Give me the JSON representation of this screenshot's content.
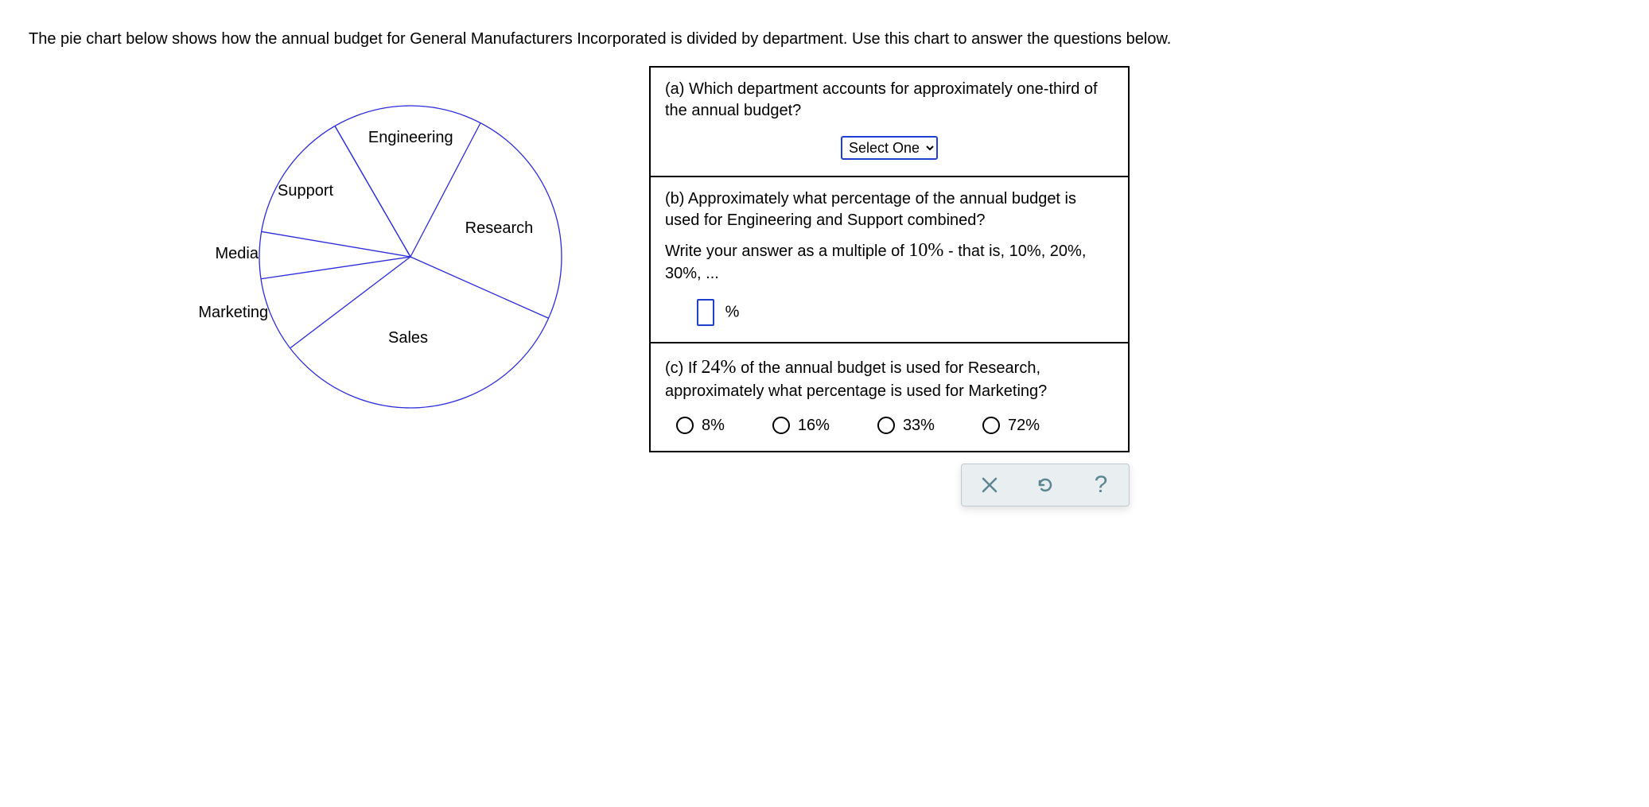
{
  "intro": "The pie chart below shows how the annual budget for General Manufacturers Incorporated is divided by department. Use this chart to answer the questions below.",
  "chart_data": {
    "type": "pie",
    "title": "",
    "categories": [
      "Engineering",
      "Research",
      "Sales",
      "Marketing",
      "Media",
      "Support"
    ],
    "values": [
      16,
      24,
      33,
      8,
      5,
      14
    ],
    "series": [
      {
        "name": "Engineering",
        "value": 16
      },
      {
        "name": "Research",
        "value": 24
      },
      {
        "name": "Sales",
        "value": 33
      },
      {
        "name": "Marketing",
        "value": 8
      },
      {
        "name": "Media",
        "value": 5
      },
      {
        "name": "Support",
        "value": 14
      }
    ],
    "start_angle_deg": -30,
    "direction": "clockwise",
    "slice_fill": "none",
    "slice_stroke": "#2b2bdc"
  },
  "questions": {
    "a": {
      "text": "(a) Which department accounts for approximately one-third of the annual budget?",
      "select_placeholder": "Select One"
    },
    "b": {
      "text1": "(b) Approximately what percentage of the annual budget is used for Engineering and Support combined?",
      "text2a": "Write your answer as a multiple of ",
      "text2_math": "10%",
      "text2b": " - that is, 10%, 20%, 30%, ...",
      "unit": "%"
    },
    "c": {
      "text1a": "(c) If ",
      "math": "24%",
      "text1b": " of the annual budget is used for Research, approximately what percentage is used for Marketing?",
      "options": [
        "8%",
        "16%",
        "33%",
        "72%"
      ]
    }
  },
  "controls": {
    "clear": "clear",
    "reset": "reset",
    "help": "?"
  }
}
